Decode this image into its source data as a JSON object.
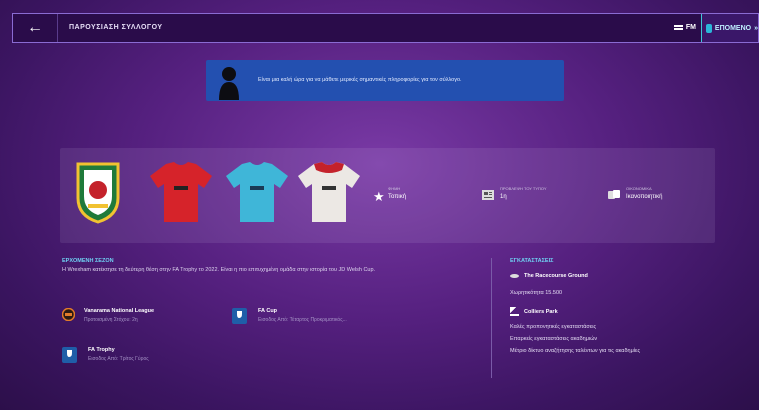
{
  "topbar": {
    "title": "ΠΑΡΟΥΣΙΑΣΗ ΣΥΛΛΟΓΟΥ",
    "fm_label": "FM",
    "next_label": "ΕΠΟΜΕΝΟ"
  },
  "banner": {
    "message": "Είναι μια καλή ώρα για να μάθετε μερικές σημαντικές πληροφορίες για τον σύλλογο."
  },
  "club": {
    "stats": [
      {
        "label": "ΦΗΜΗ",
        "value": "Τοπική"
      },
      {
        "label": "ΠΡΟΒΛΕΨΗ ΤΟΥ ΤΥΠΟΥ",
        "value": "1η"
      },
      {
        "label": "ΟΙΚΟΝΟΜΙΚΑ",
        "value": "Ικανοποιητική"
      }
    ]
  },
  "season": {
    "title": "ΕΡΧΟΜΕΝΗ ΣΕΖΟΝ",
    "text": "Η Wrexham κατέκτησε τη δεύτερη θέση στην FA Trophy το 2022. Είναι η πιο επιτυχημένη ομάδα στην ιστορία του JD Welsh Cup.",
    "competitions": [
      {
        "name": "Vanarama National League",
        "sub": "Προτοισμένη Στόχου: 2η"
      },
      {
        "name": "FA Cup",
        "sub": "Εισοδος Από: Τέταρτος Προκριματικός..."
      },
      {
        "name": "FA Trophy",
        "sub": "Εισοδος Από: Τρίτος Γύρος"
      }
    ]
  },
  "facilities": {
    "title": "ΕΓΚΑΤΑΣΤΑΣΕΙΣ",
    "stadium_name": "The Racecourse Ground",
    "stadium_capacity": "Χωρητικότητα 15.500",
    "training_name": "Colliers Park",
    "lines": [
      "Καλές προπονητικές εγκαταστάσεις",
      "Επαρκείς εγκαταστάσεις ακαδημιών",
      "Μέτριο δίκτυο αναζήτησης ταλέντων για τις ακαδημίες"
    ]
  },
  "colors": {
    "accent": "#6fd0f3",
    "banner": "#2350b0",
    "home_kit": "#d6232a",
    "away_kit": "#3fb6d8",
    "third_kit": "#ece8e4"
  }
}
